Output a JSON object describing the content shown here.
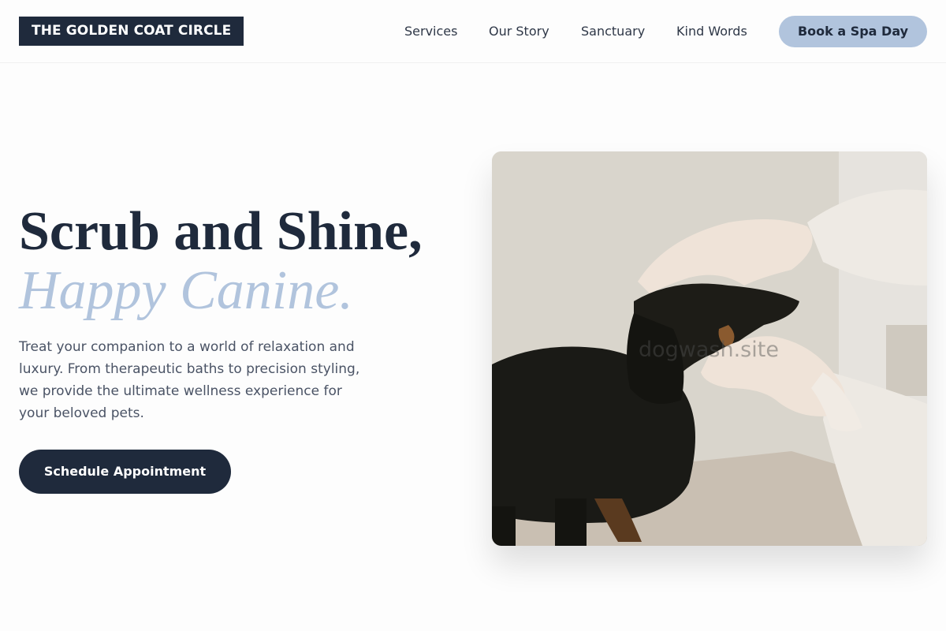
{
  "header": {
    "logo": "THE GOLDEN COAT CIRCLE",
    "nav": [
      "Services",
      "Our Story",
      "Sanctuary",
      "Kind Words"
    ],
    "cta": "Book a Spa Day"
  },
  "hero": {
    "headline": "Scrub and Shine,",
    "headline_accent": "Happy Canine.",
    "description": "Treat your companion to a world of relaxation and luxury. From therapeutic baths to precision styling, we provide the ultimate wellness experience for your beloved pets.",
    "cta": "Schedule Appointment",
    "image_watermark": "dogwash.site"
  },
  "colors": {
    "navy": "#1f2a3c",
    "accent_blue": "#b1c4dd",
    "body_text": "#4a5365",
    "background": "#fdfdfd"
  }
}
